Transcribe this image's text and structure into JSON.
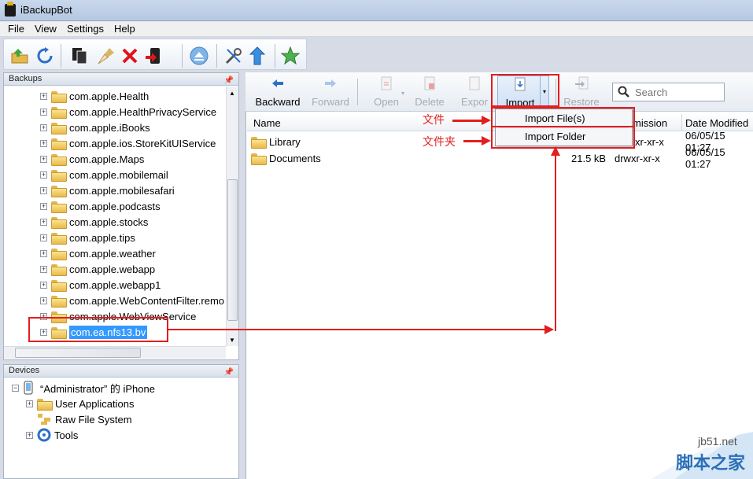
{
  "window": {
    "title": "iBackupBot"
  },
  "menu": [
    "File",
    "View",
    "Settings",
    "Help"
  ],
  "backups_panel": {
    "title": "Backups",
    "items": [
      "com.apple.Health",
      "com.apple.HealthPrivacyService",
      "com.apple.iBooks",
      "com.apple.ios.StoreKitUIService",
      "com.apple.Maps",
      "com.apple.mobilemail",
      "com.apple.mobilesafari",
      "com.apple.podcasts",
      "com.apple.stocks",
      "com.apple.tips",
      "com.apple.weather",
      "com.apple.webapp",
      "com.apple.webapp1",
      "com.apple.WebContentFilter.remo",
      "com.apple.WebViewService",
      "com.ea.nfs13.bv"
    ],
    "selected": "com.ea.nfs13.bv"
  },
  "devices_panel": {
    "title": "Devices",
    "device": "“Administrator” 的 iPhone",
    "children": [
      "User Applications",
      "Raw File System",
      "Tools"
    ]
  },
  "file_toolbar": {
    "backward": "Backward",
    "forward": "Forward",
    "open": "Open",
    "delete": "Delete",
    "export": "Expor",
    "import": "Import",
    "restore": "Restore",
    "search_placeholder": "Search"
  },
  "file_list": {
    "columns": [
      "Name",
      "mission",
      "Date Modified"
    ],
    "rows": [
      {
        "name": "Library",
        "size": "",
        "permission": "xr-xr-x",
        "date": "06/05/15 01:27"
      },
      {
        "name": "Documents",
        "size": "21.5 kB",
        "permission": "drwxr-xr-x",
        "date": "06/05/15 01:27"
      }
    ]
  },
  "import_menu": {
    "items": [
      "Import File(s)",
      "Import Folder"
    ]
  },
  "annotations": {
    "file_label": "文件",
    "folder_label": "文件夹"
  },
  "watermark": {
    "site": "jb51.net",
    "name": "脚本之家"
  },
  "colors": {
    "accent": "#e21e1e",
    "selection": "#3399ff"
  }
}
